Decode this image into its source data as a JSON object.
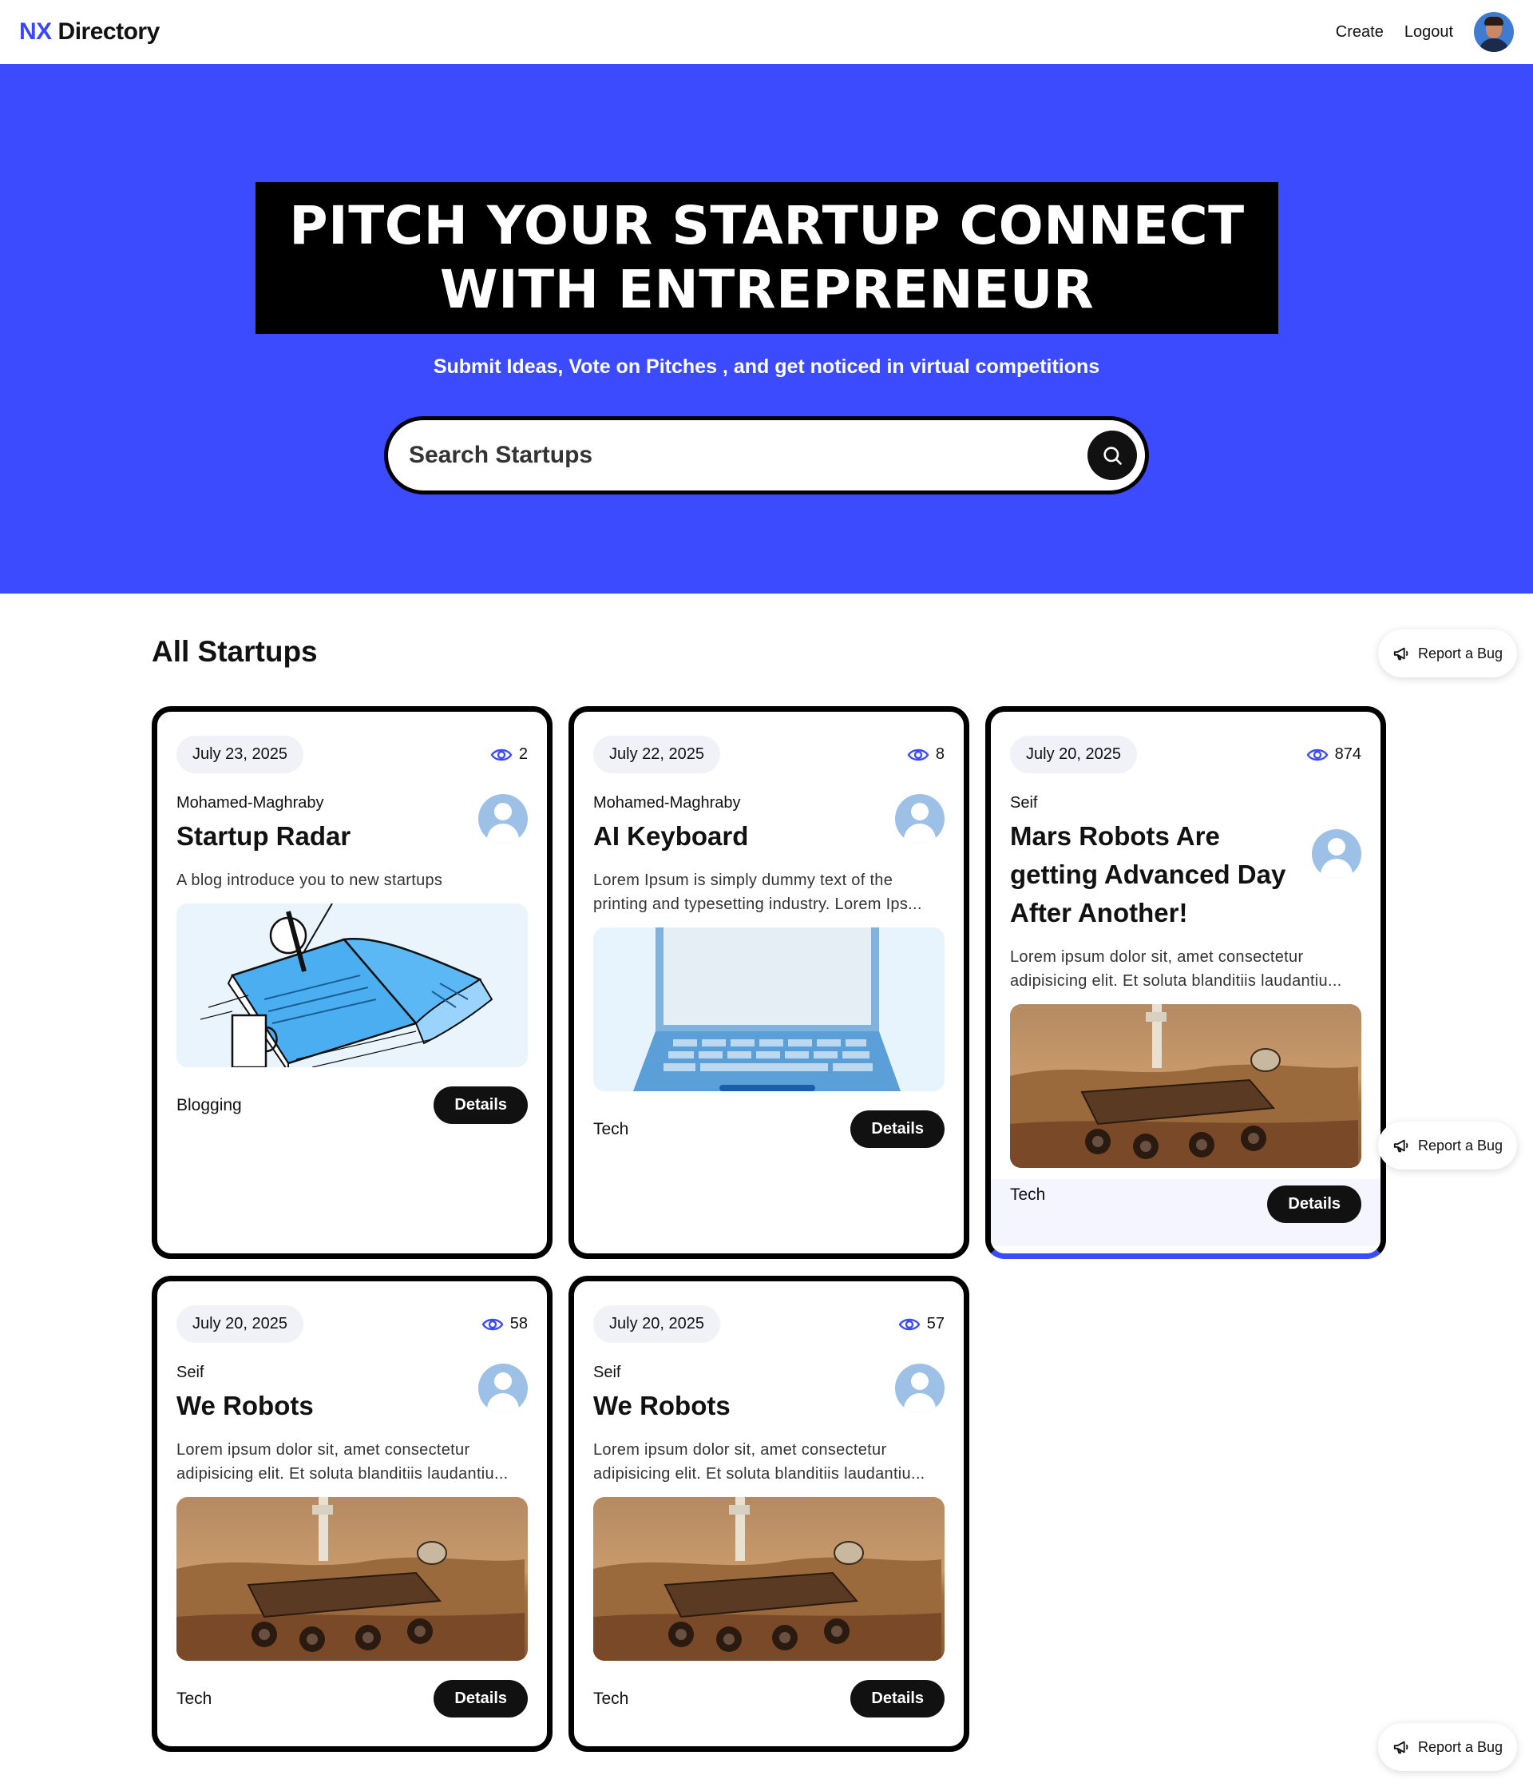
{
  "nav": {
    "logo_prefix": "NX",
    "logo_suffix": "Directory",
    "create_label": "Create",
    "logout_label": "Logout"
  },
  "hero": {
    "headline_line1": "PITCH YOUR STARTUP CONNECT",
    "headline_line2": "WITH ENTREPRENEUR",
    "subtitle": "Submit Ideas, Vote on Pitches , and get noticed in virtual competitions",
    "search_placeholder": "Search Startups",
    "accent_color": "#3d4bff"
  },
  "section": {
    "title": "All Startups"
  },
  "cards": [
    {
      "date": "July 23, 2025",
      "views": "2",
      "author": "Mohamed-Maghraby",
      "title": "Startup Radar",
      "description": "A blog introduce you to new startups",
      "image": "book-illustration",
      "category": "Blogging",
      "details_label": "Details"
    },
    {
      "date": "July 22, 2025",
      "views": "8",
      "author": "Mohamed-Maghraby",
      "title": "AI Keyboard",
      "description": "Lorem Ipsum is simply dummy text of the printing and typesetting industry. Lorem Ips...",
      "image": "laptop-illustration",
      "category": "Tech",
      "details_label": "Details"
    },
    {
      "date": "July 20, 2025",
      "views": "874",
      "author": "Seif",
      "title": "Mars Robots Are getting Advanced Day After Another!",
      "description": "Lorem ipsum dolor sit, amet consectetur adipisicing elit. Et soluta blanditiis laudantiu...",
      "image": "mars-rover-photo",
      "category": "Tech",
      "details_label": "Details"
    },
    {
      "date": "July 20, 2025",
      "views": "58",
      "author": "Seif",
      "title": "We Robots",
      "description": "Lorem ipsum dolor sit, amet consectetur adipisicing elit. Et soluta blanditiis laudantiu...",
      "image": "mars-rover-photo",
      "category": "Tech",
      "details_label": "Details"
    },
    {
      "date": "July 20, 2025",
      "views": "57",
      "author": "Seif",
      "title": "We Robots",
      "description": "Lorem ipsum dolor sit, amet consectetur adipisicing elit. Et soluta blanditiis laudantiu...",
      "image": "mars-rover-photo",
      "category": "Tech",
      "details_label": "Details"
    }
  ],
  "report_bug": {
    "label": "Report a Bug",
    "icon": "megaphone-icon"
  }
}
